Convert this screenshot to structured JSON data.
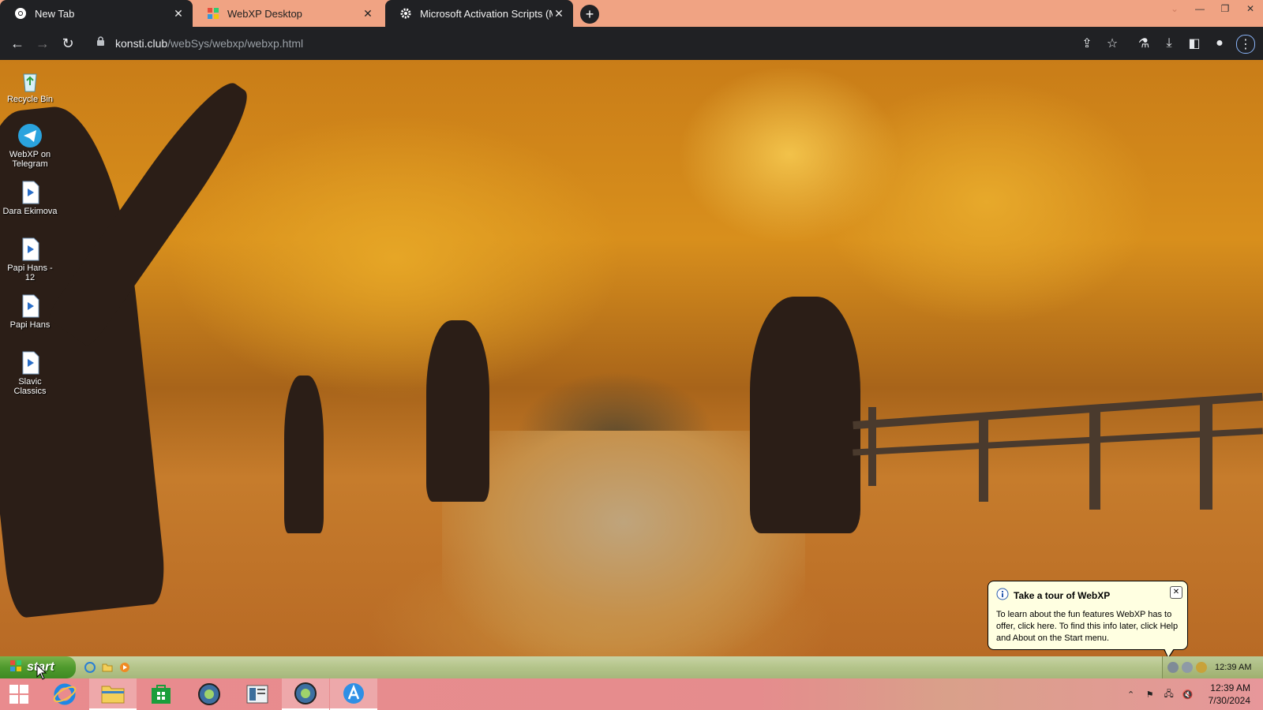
{
  "browser": {
    "tabs": [
      {
        "title": "New Tab",
        "favicon": "chrome-icon",
        "close": "✕"
      },
      {
        "title": "WebXP Desktop",
        "favicon": "windows-xp-icon",
        "close": "✕"
      },
      {
        "title": "Microsoft Activation Scripts (MA",
        "favicon": "gear-icon",
        "close": "✕"
      }
    ],
    "new_tab": "+",
    "url_host": "konsti.club",
    "url_path": "/webSys/webxp/webxp.html"
  },
  "desktop": {
    "icons": [
      {
        "label": "Recycle Bin",
        "icon": "recycle-bin-icon"
      },
      {
        "label": "WebXP on Telegram",
        "icon": "telegram-icon"
      },
      {
        "label": "Dara Ekimova",
        "icon": "media-file-icon"
      },
      {
        "label": "Papi Hans - 12",
        "icon": "media-file-icon"
      },
      {
        "label": "Papi Hans",
        "icon": "media-file-icon"
      },
      {
        "label": "Slavic Classics",
        "icon": "media-file-icon"
      }
    ]
  },
  "balloon": {
    "title": "Take a tour of WebXP",
    "body": "To learn about the fun features WebXP has to offer, click here. To find this info later, click Help and About on the Start menu.",
    "close": "✕"
  },
  "xp_taskbar": {
    "start_label": "start",
    "clock": "12:39 AM"
  },
  "win_taskbar": {
    "time": "12:39 AM",
    "date": "7/30/2024"
  },
  "colors": {
    "tab_strip": "#f0a383",
    "chrome_dark": "#202124",
    "xp_green": "#4f9a2d",
    "balloon_bg": "#ffffe1"
  }
}
